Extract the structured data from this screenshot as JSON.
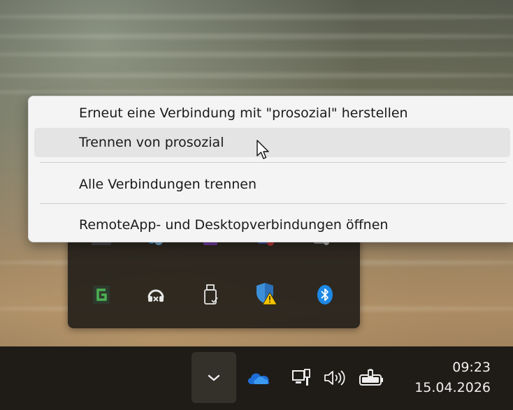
{
  "context_menu": {
    "items": [
      {
        "label": "Erneut eine Verbindung mit \"prosozial\" herstellen"
      },
      {
        "label": "Trennen von prosozial",
        "hovered": true
      },
      {
        "label": "Alle Verbindungen trennen"
      },
      {
        "label": "RemoteApp- und Desktopverbindungen öffnen"
      }
    ]
  },
  "tray_overflow": {
    "icons": [
      {
        "name": "greenshot-icon",
        "color": "#4caf50"
      },
      {
        "name": "headset-icon",
        "color": "#e6e6e6"
      },
      {
        "name": "usb-drive-icon",
        "color": "#e6e6e6"
      },
      {
        "name": "security-warning-shield-icon",
        "color": "#3d8fd8"
      },
      {
        "name": "bluetooth-icon",
        "color": "#1e88e5"
      }
    ]
  },
  "taskbar": {
    "icons": [
      "chevron-up-icon",
      "onedrive-cloud-icon",
      "network-icon",
      "volume-icon",
      "battery-charging-icon"
    ],
    "accent": "#1e6ed8"
  },
  "clock": {
    "time": "09:23",
    "date": "15.04.2026"
  }
}
